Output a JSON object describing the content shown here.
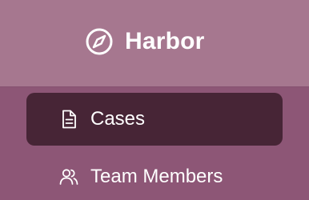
{
  "brand": {
    "name": "Harbor",
    "logo_icon": "compass-icon"
  },
  "nav": {
    "items": [
      {
        "label": "Cases",
        "icon": "document-icon",
        "active": true
      },
      {
        "label": "Team Members",
        "icon": "users-icon",
        "active": false
      }
    ]
  },
  "colors": {
    "sidebar_bg": "#8d5676",
    "brand_bg": "#a6778f",
    "active_bg": "#472536",
    "text": "#ffffff"
  }
}
